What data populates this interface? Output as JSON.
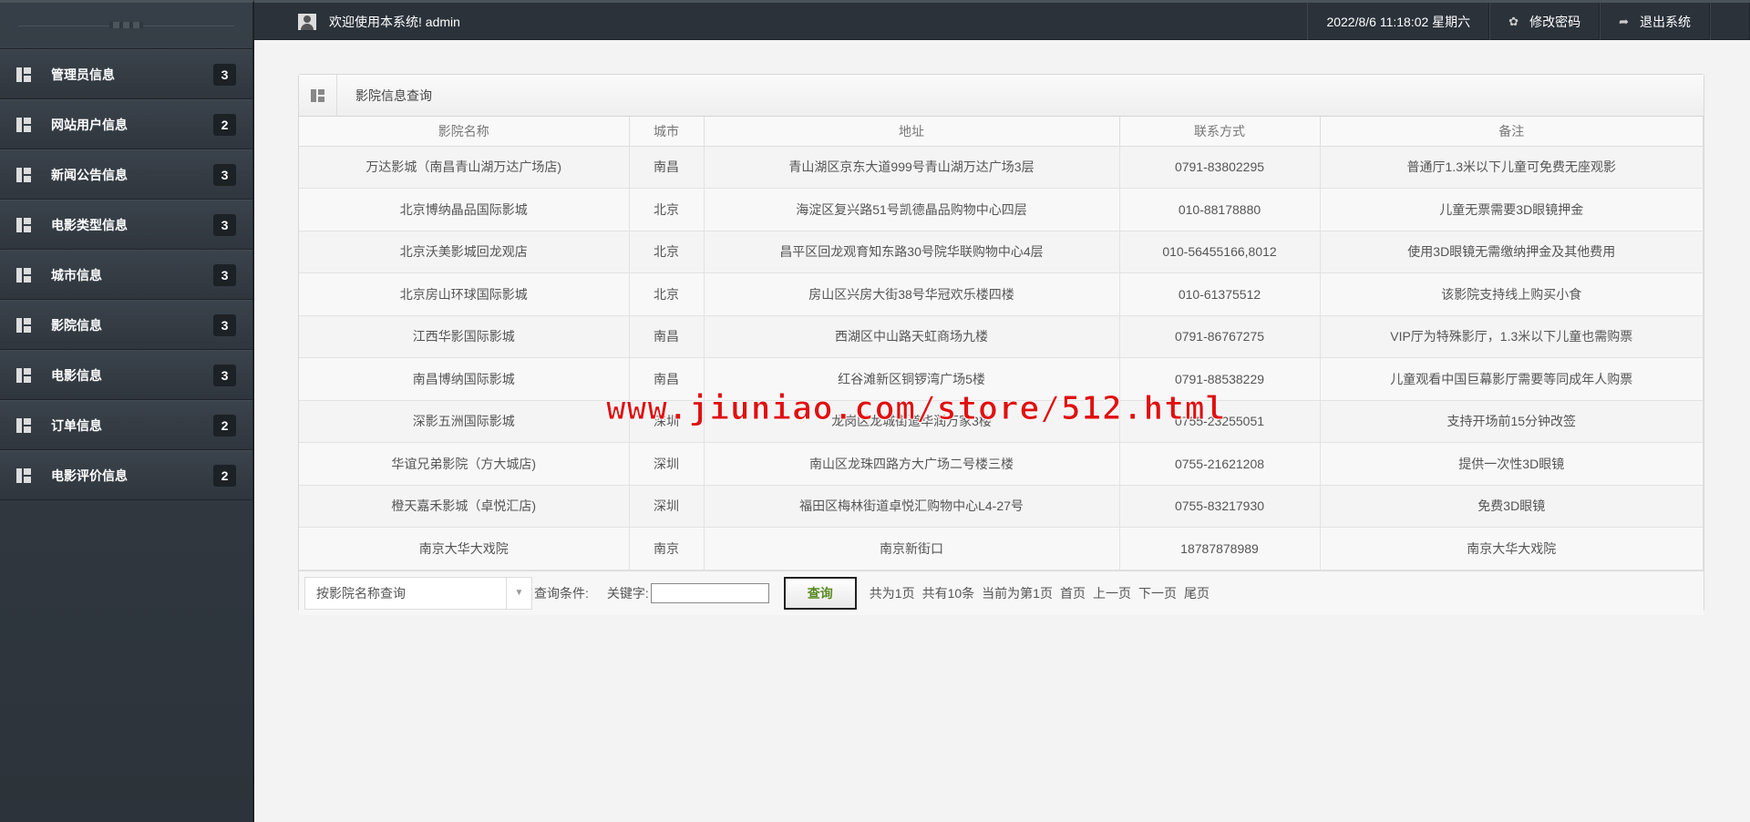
{
  "header": {
    "welcome": "欢迎使用本系统! admin",
    "datetime": "2022/8/6 11:18:02 星期六",
    "change_password": "修改密码",
    "logout": "退出系统"
  },
  "sidebar": {
    "items": [
      {
        "label": "管理员信息",
        "count": "3"
      },
      {
        "label": "网站用户信息",
        "count": "2"
      },
      {
        "label": "新闻公告信息",
        "count": "3"
      },
      {
        "label": "电影类型信息",
        "count": "3"
      },
      {
        "label": "城市信息",
        "count": "3"
      },
      {
        "label": "影院信息",
        "count": "3"
      },
      {
        "label": "电影信息",
        "count": "3"
      },
      {
        "label": "订单信息",
        "count": "2"
      },
      {
        "label": "电影评价信息",
        "count": "2"
      }
    ]
  },
  "panel": {
    "title": "影院信息查询",
    "columns": [
      "影院名称",
      "城市",
      "地址",
      "联系方式",
      "备注"
    ],
    "rows": [
      [
        "万达影城（南昌青山湖万达广场店)",
        "南昌",
        "青山湖区京东大道999号青山湖万达广场3层",
        "0791-83802295",
        "普通厅1.3米以下儿童可免费无座观影"
      ],
      [
        "北京博纳晶品国际影城",
        "北京",
        "海淀区复兴路51号凯德晶品购物中心四层",
        "010-88178880",
        "儿童无票需要3D眼镜押金"
      ],
      [
        "北京沃美影城回龙观店",
        "北京",
        "昌平区回龙观育知东路30号院华联购物中心4层",
        "010-56455166,8012",
        "使用3D眼镜无需缴纳押金及其他费用"
      ],
      [
        "北京房山环球国际影城",
        "北京",
        "房山区兴房大街38号华冠欢乐楼四楼",
        "010-61375512",
        "该影院支持线上购买小食"
      ],
      [
        "江西华影国际影城",
        "南昌",
        "西湖区中山路天虹商场九楼",
        "0791-86767275",
        "VIP厅为特殊影厅，1.3米以下儿童也需购票"
      ],
      [
        "南昌博纳国际影城",
        "南昌",
        "红谷滩新区铜锣湾广场5楼",
        "0791-88538229",
        "儿童观看中国巨幕影厅需要等同成年人购票"
      ],
      [
        "深影五洲国际影城",
        "深圳",
        "龙岗区龙城街道华润万家3楼",
        "0755-23255051",
        "支持开场前15分钟改签"
      ],
      [
        "华谊兄弟影院（方大城店)",
        "深圳",
        "南山区龙珠四路方大广场二号楼三楼",
        "0755-21621208",
        "提供一次性3D眼镜"
      ],
      [
        "橙天嘉禾影城（卓悦汇店)",
        "深圳",
        "福田区梅林街道卓悦汇购物中心L4-27号",
        "0755-83217930",
        "免费3D眼镜"
      ],
      [
        "南京大华大戏院",
        "南京",
        "南京新街口",
        "18787878989",
        "南京大华大戏院"
      ]
    ]
  },
  "footer": {
    "select_value": "按影院名称查询",
    "condition_label": "查询条件:",
    "keyword_label": "关键字:",
    "keyword_value": "",
    "query_button": "查询",
    "pager": [
      "共为1页",
      "共有10条",
      "当前为第1页",
      "首页",
      "上一页",
      "下一页",
      "尾页"
    ]
  },
  "watermark": "www.jiuniao.com/store/512.html"
}
